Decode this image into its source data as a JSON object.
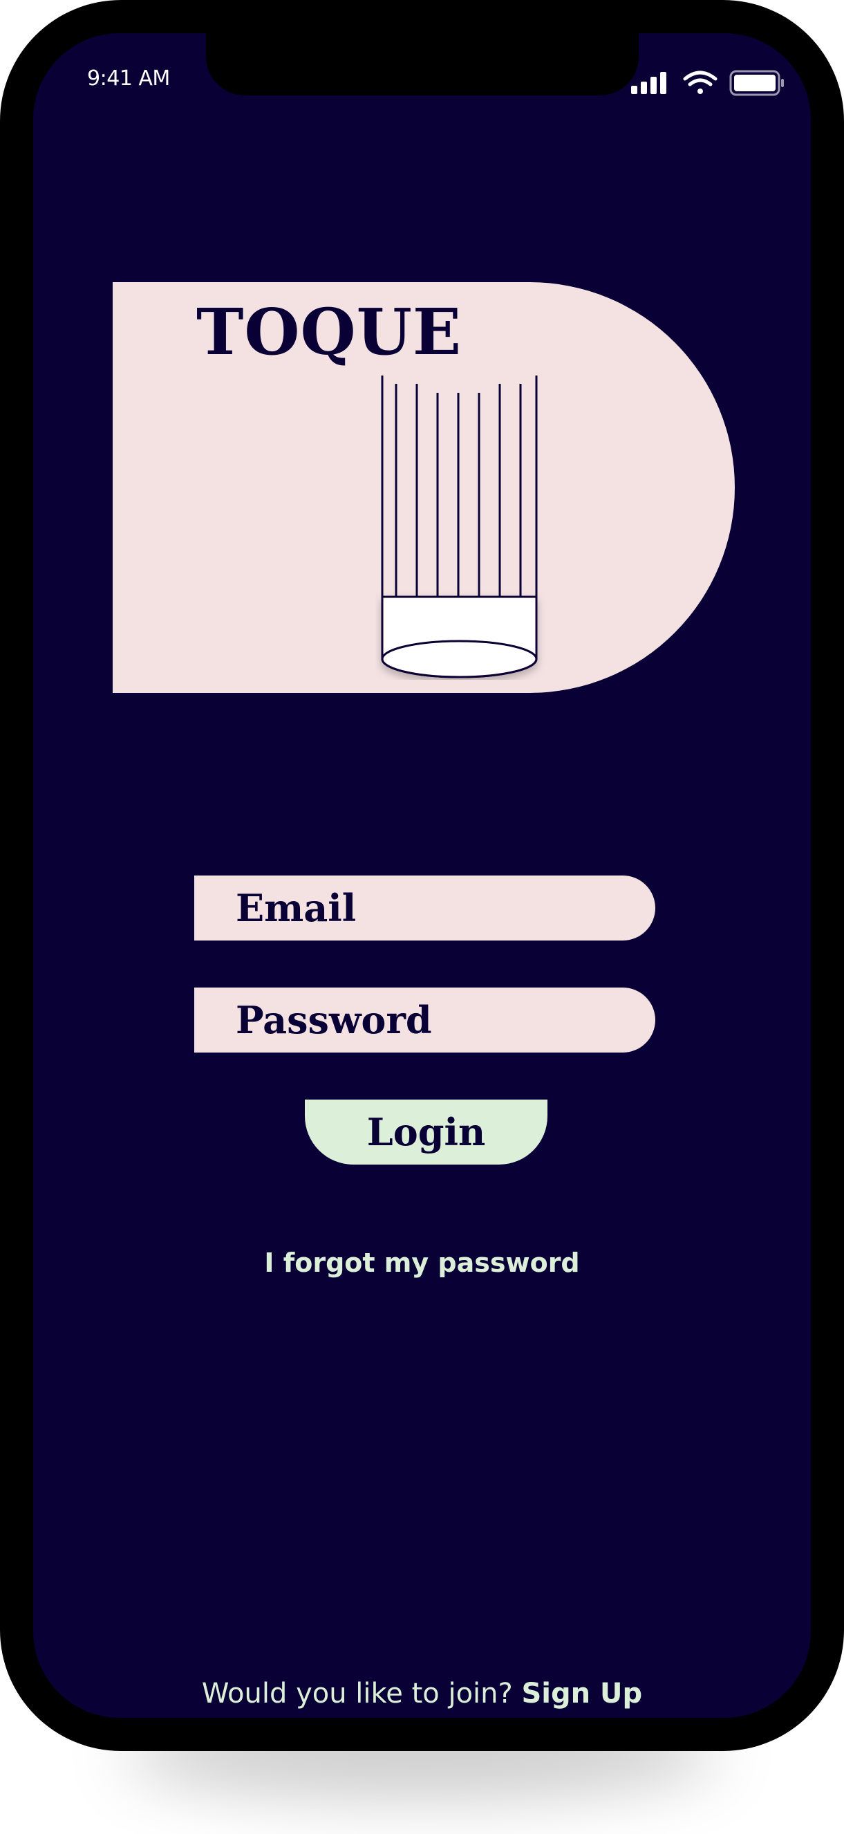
{
  "status_bar": {
    "time": "9:41 AM",
    "icons": [
      "cellular-signal-icon",
      "wifi-icon",
      "battery-icon"
    ]
  },
  "brand": {
    "title": "TOQUE",
    "logo_icon": "chef-hat-icon"
  },
  "login_form": {
    "email_placeholder": "Email",
    "password_placeholder": "Password",
    "login_label": "Login",
    "forgot_label": "I forgot my password"
  },
  "signup": {
    "prompt": "Would you like to join?",
    "link_label": "Sign Up"
  },
  "colors": {
    "background": "#090035",
    "panel": "#f4e2e3",
    "accent": "#dcefd8",
    "text_dark": "#090035"
  }
}
